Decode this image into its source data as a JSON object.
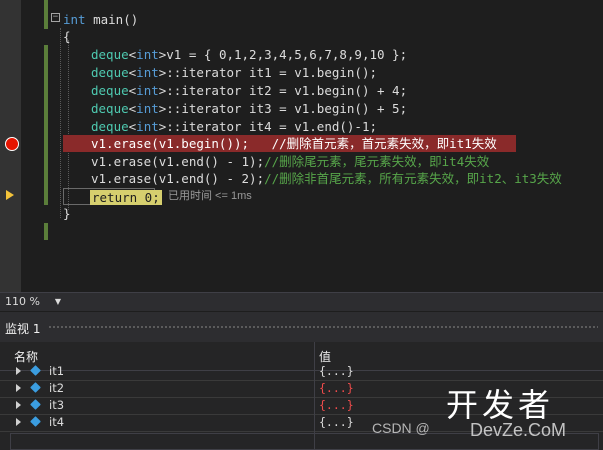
{
  "editor": {
    "lines": [
      {
        "k": "int",
        "t": " main()"
      },
      {
        "t": "{"
      },
      {
        "ty": "deque",
        "l": "<",
        "k": "int",
        "r": ">v1 = { 0,1,2,3,4,5,6,7,8,9,10 };"
      },
      {
        "ty": "deque",
        "l": "<",
        "k": "int",
        "r": ">::iterator it1 = v1.begin();"
      },
      {
        "ty": "deque",
        "l": "<",
        "k": "int",
        "r": ">::iterator it2 = v1.begin() + 4;"
      },
      {
        "ty": "deque",
        "l": "<",
        "k": "int",
        "r": ">::iterator it3 = v1.begin() + 5;"
      },
      {
        "ty": "deque",
        "l": "<",
        "k": "int",
        "r": ">::iterator it4 = v1.end()-1;"
      },
      {
        "code": "v1.erase(v1.begin());   ",
        "c": "//删除首元素，首元素失效，即it1失效"
      },
      {
        "code": "v1.erase(v1.end() - 1);",
        "c": "//删除尾元素，尾元素失效，即it4失效"
      },
      {
        "code": "v1.erase(v1.end() - 2);",
        "c": "//删除非首尾元素，所有元素失效，即it2、it3失效"
      },
      {
        "k": "return",
        "t": " 0;",
        "tip": "已用时间 <= 1ms"
      },
      {
        "t": "}"
      }
    ]
  },
  "zoom": {
    "value": "110 %"
  },
  "watch": {
    "title": "监视 1",
    "col_name": "名称",
    "col_value": "值",
    "rows": [
      {
        "name": "it1",
        "value": "{...}",
        "value_color": "#dcdcdc"
      },
      {
        "name": "it2",
        "value": "{...}",
        "value_color": "#f14c4c"
      },
      {
        "name": "it3",
        "value": "{...}",
        "value_color": "#f14c4c"
      },
      {
        "name": "it4",
        "value": "{...}",
        "value_color": "#dcdcdc"
      }
    ]
  },
  "watermark": {
    "csdn": "CSDN @",
    "brand": "开发者",
    "site": "DevZe.CoM"
  }
}
